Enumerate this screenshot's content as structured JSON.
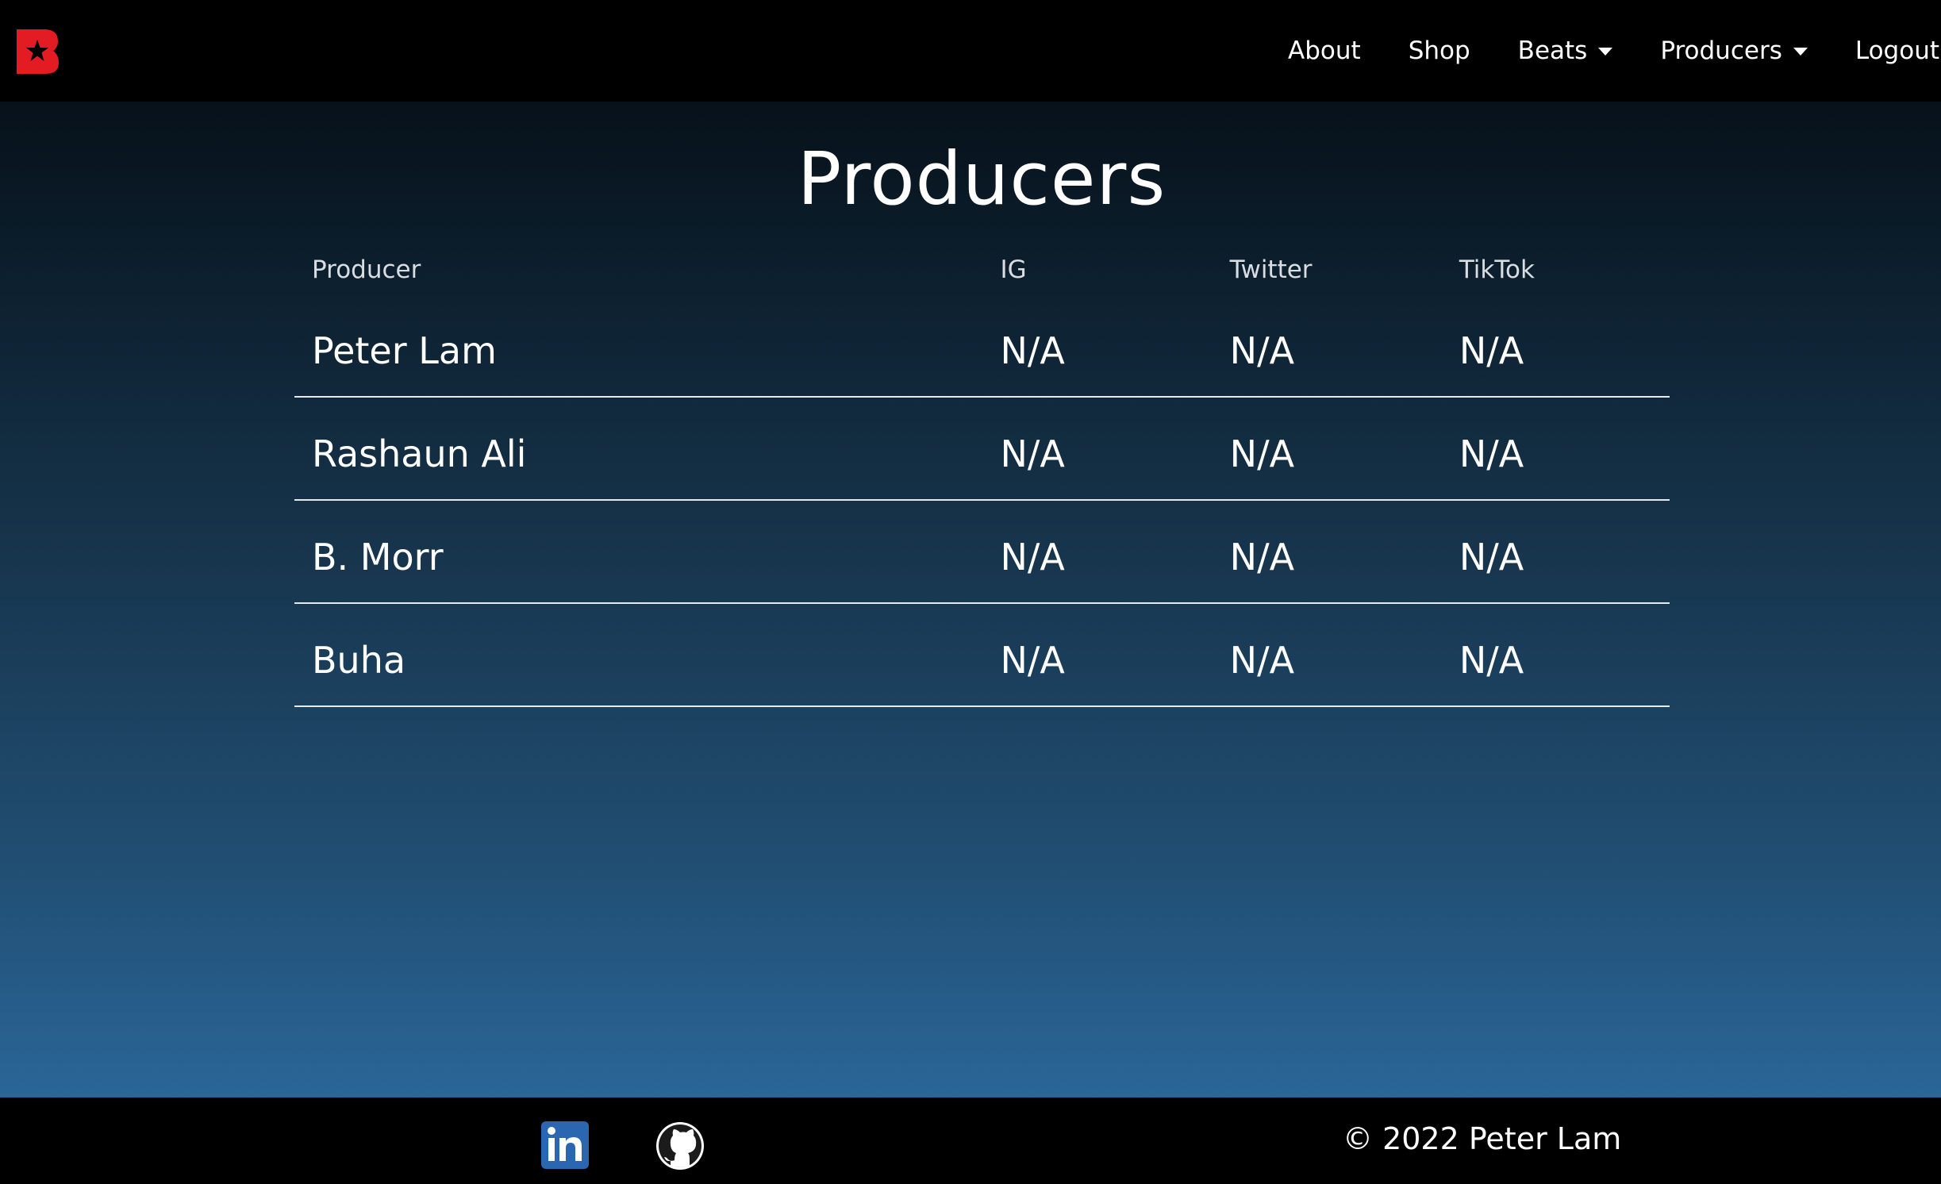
{
  "nav": {
    "logo_icon": "beatstars-logo-icon",
    "brand_color": "#e31b23",
    "links": {
      "about": "About",
      "shop": "Shop",
      "beats": "Beats",
      "producers": "Producers",
      "logout": "Logout"
    }
  },
  "main": {
    "title": "Producers",
    "table": {
      "headers": [
        "Producer",
        "IG",
        "Twitter",
        "TikTok"
      ],
      "rows": [
        {
          "producer": "Peter Lam",
          "ig": "N/A",
          "twitter": "N/A",
          "tiktok": "N/A"
        },
        {
          "producer": "Rashaun Ali",
          "ig": "N/A",
          "twitter": "N/A",
          "tiktok": "N/A"
        },
        {
          "producer": "B. Morr",
          "ig": "N/A",
          "twitter": "N/A",
          "tiktok": "N/A"
        },
        {
          "producer": "Buha",
          "ig": "N/A",
          "twitter": "N/A",
          "tiktok": "N/A"
        }
      ]
    }
  },
  "footer": {
    "icons": [
      "linkedin-icon",
      "github-icon"
    ],
    "linkedin_color": "#2b67b1",
    "copyright": "© 2022 Peter Lam"
  }
}
